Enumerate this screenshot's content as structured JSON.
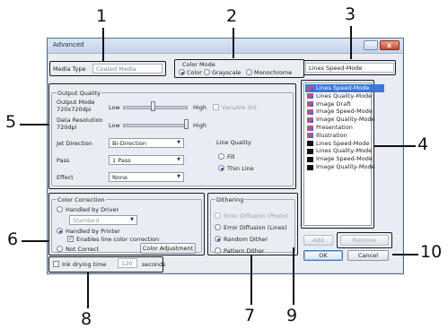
{
  "window": {
    "title": "Advanced"
  },
  "media": {
    "label": "Media Type",
    "value": "Coated Media"
  },
  "color_mode": {
    "title": "Color Mode",
    "options": [
      {
        "label": "Color",
        "selected": true
      },
      {
        "label": "Grayscale",
        "selected": false
      },
      {
        "label": "Monochrome",
        "selected": false
      }
    ]
  },
  "mode_name": "Lines Speed-Mode",
  "output_quality": {
    "title": "Output Quality",
    "output_mode_label": "Output Mode",
    "output_mode_value": "720x720dpi",
    "output_low": "Low",
    "output_high": "High",
    "output_level": 0.45,
    "variable_dot": "Variable dot",
    "data_res_label": "Data Resolution",
    "data_res_value": "720dpi",
    "data_low": "Low",
    "data_high": "High",
    "data_level": 1.0,
    "jet_label": "Jet Direction",
    "jet_value": "Bi-Direction",
    "pass_label": "Pass",
    "pass_value": "1 Pass",
    "effect_label": "Effect",
    "effect_value": "None",
    "line_quality_title": "Line Quality",
    "line_quality_options": [
      {
        "label": "Fill",
        "selected": false
      },
      {
        "label": "Thin Line",
        "selected": true
      }
    ]
  },
  "color_correction": {
    "title": "Color Correction",
    "by_driver": "Handled by Driver",
    "driver_select": "Standard",
    "by_printer": "Handled by Printer",
    "enable_line": "Enables line color correction",
    "not_correct": "Not Correct",
    "adjust_button": "Color Adjustment"
  },
  "dithering": {
    "title": "Dithering",
    "options": [
      {
        "label": "Error Diffusion (Photo)",
        "selected": false,
        "disabled": true
      },
      {
        "label": "Error Diffusion (Lines)",
        "selected": false,
        "disabled": false
      },
      {
        "label": "Random Dither",
        "selected": true,
        "disabled": false
      },
      {
        "label": "Pattern Dither",
        "selected": false,
        "disabled": false
      }
    ]
  },
  "mode_list": [
    {
      "label": "Lines Speed-Mode",
      "icon": "color",
      "selected": true
    },
    {
      "label": "Lines Quality-Mode",
      "icon": "color",
      "selected": false
    },
    {
      "label": "Image Draft",
      "icon": "color",
      "selected": false
    },
    {
      "label": "Image Speed-Mode",
      "icon": "color",
      "selected": false
    },
    {
      "label": "Image Quality-Mode",
      "icon": "color",
      "selected": false
    },
    {
      "label": "Presentation",
      "icon": "color",
      "selected": false
    },
    {
      "label": "Illustration",
      "icon": "color",
      "selected": false
    },
    {
      "label": "Lines Speed-Mode",
      "icon": "black",
      "selected": false
    },
    {
      "label": "Lines Quality-Mode",
      "icon": "black",
      "selected": false
    },
    {
      "label": "Image Speed-Mode",
      "icon": "black",
      "selected": false
    },
    {
      "label": "Image Quality-Mode",
      "icon": "black",
      "selected": false
    }
  ],
  "buttons": {
    "add": "Add",
    "remove": "Remove",
    "ok": "OK",
    "cancel": "Cancel"
  },
  "ink_drying": {
    "label": "Ink drying time",
    "value": "120",
    "unit": "seconds"
  },
  "callouts": [
    "1",
    "2",
    "3",
    "4",
    "5",
    "6",
    "7",
    "8",
    "9",
    "10"
  ],
  "colors": {
    "accent": "#3b78d8",
    "title_bar": "#c2d3ea",
    "close": "#c6482e"
  }
}
